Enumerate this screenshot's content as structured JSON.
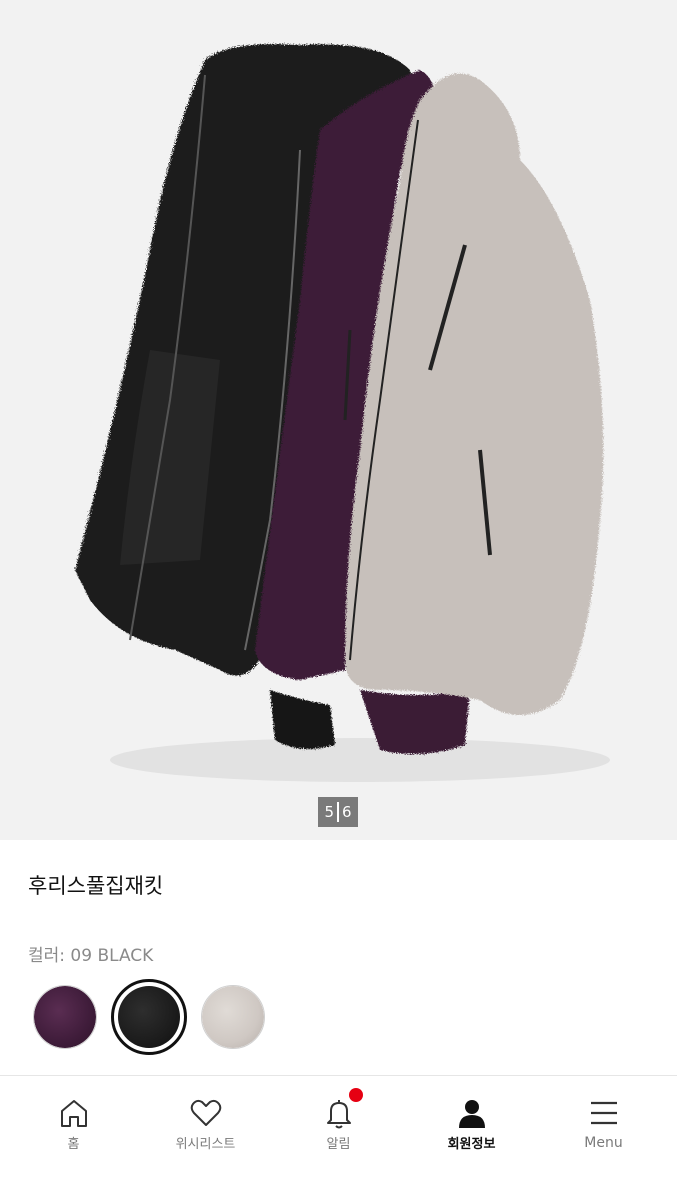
{
  "gallery": {
    "current": "5",
    "total": "6"
  },
  "product": {
    "title": "후리스풀집재킷",
    "color_label": "컬러: 09 BLACK"
  },
  "swatches": [
    {
      "name": "purple",
      "color": "#4a2240",
      "selected": false
    },
    {
      "name": "black",
      "color": "#1c1c1c",
      "selected": true
    },
    {
      "name": "light-gray",
      "color": "#cfc8c3",
      "selected": false
    }
  ],
  "nav": {
    "items": [
      {
        "label": "홈",
        "icon": "home-icon",
        "active": false
      },
      {
        "label": "위시리스트",
        "icon": "heart-icon",
        "active": false
      },
      {
        "label": "알림",
        "icon": "bell-icon",
        "active": false,
        "badge": true
      },
      {
        "label": "회원정보",
        "icon": "user-icon",
        "active": true
      },
      {
        "label": "Menu",
        "icon": "menu-icon",
        "active": false
      }
    ]
  },
  "colors": {
    "badge": "#e60012",
    "accent": "#111111"
  }
}
